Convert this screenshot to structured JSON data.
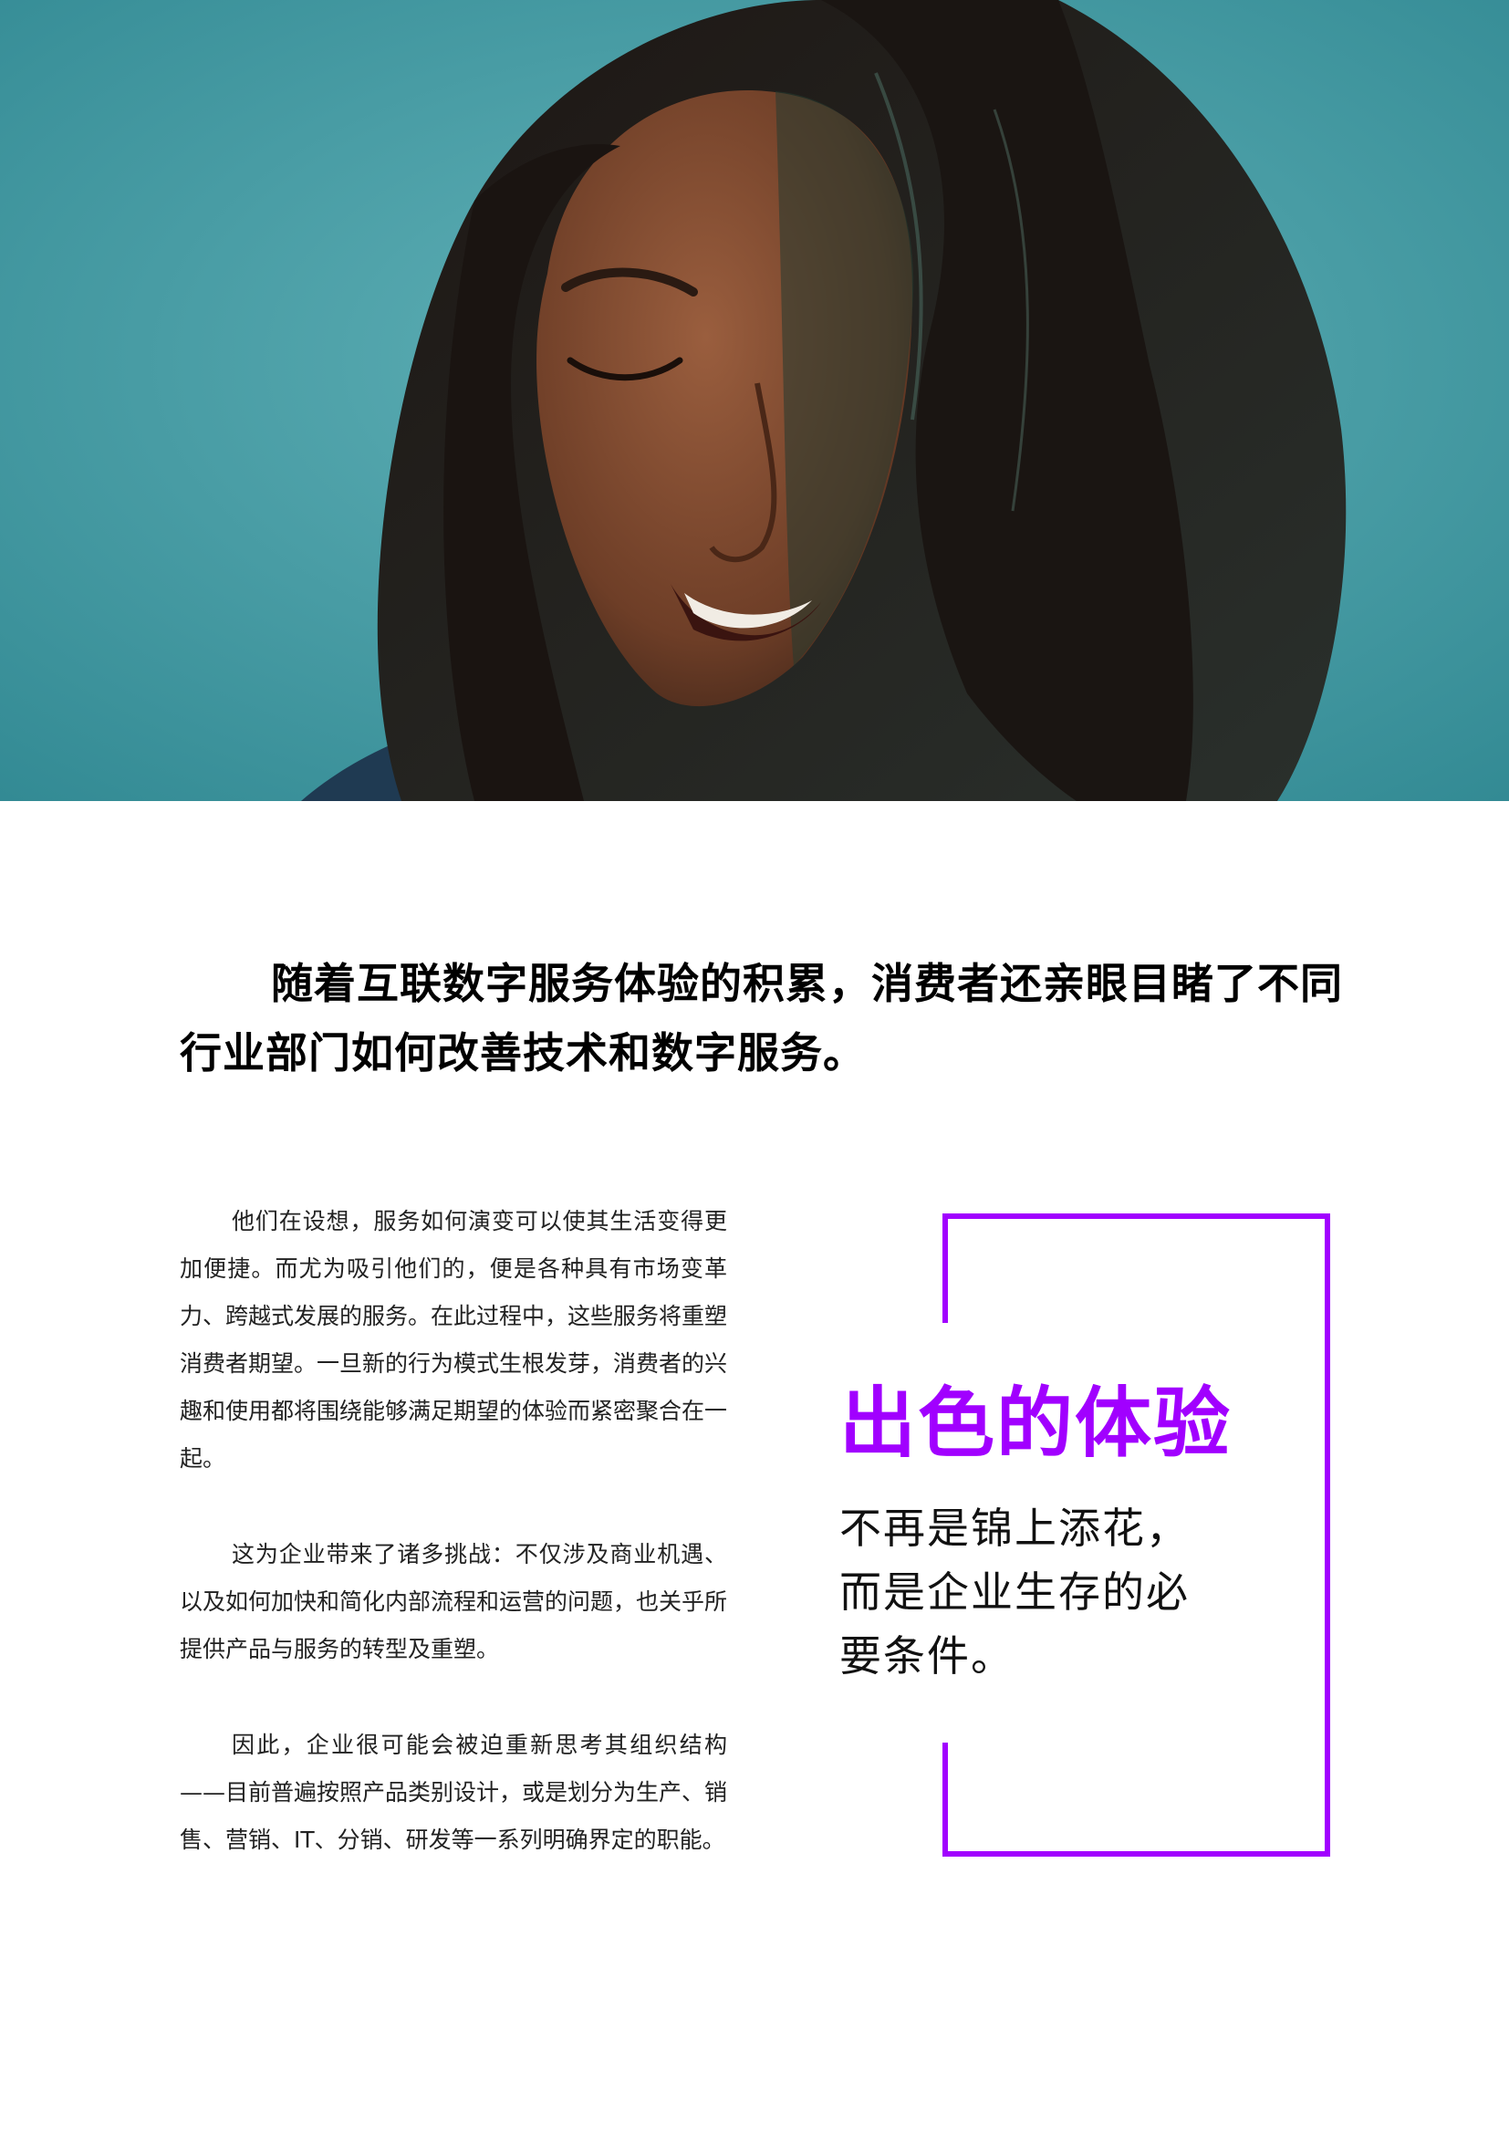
{
  "headline": "随着互联数字服务体验的积累，消费者还亲眼目睹了不同行业部门如何改善技术和数字服务。",
  "body": {
    "paragraphs": [
      "他们在设想，服务如何演变可以使其生活变得更加便捷。而尤为吸引他们的，便是各种具有市场变革力、跨越式发展的服务。在此过程中，这些服务将重塑消费者期望。一旦新的行为模式生根发芽，消费者的兴趣和使用都将围绕能够满足期望的体验而紧密聚合在一起。",
      "这为企业带来了诸多挑战：不仅涉及商业机遇、以及如何加快和简化内部流程和运营的问题，也关乎所提供产品与服务的转型及重塑。",
      "因此，企业很可能会被迫重新思考其组织结构——目前普遍按照产品类别设计，或是划分为生产、销售、营销、IT、分销、研发等一系列明确界定的职能。"
    ]
  },
  "callout": {
    "title": "出色的体验",
    "text": "不再是锦上添花，而是企业生存的必要条件。"
  },
  "colors": {
    "accent": "#a100ff",
    "hero_background": "#3f9aa3"
  }
}
